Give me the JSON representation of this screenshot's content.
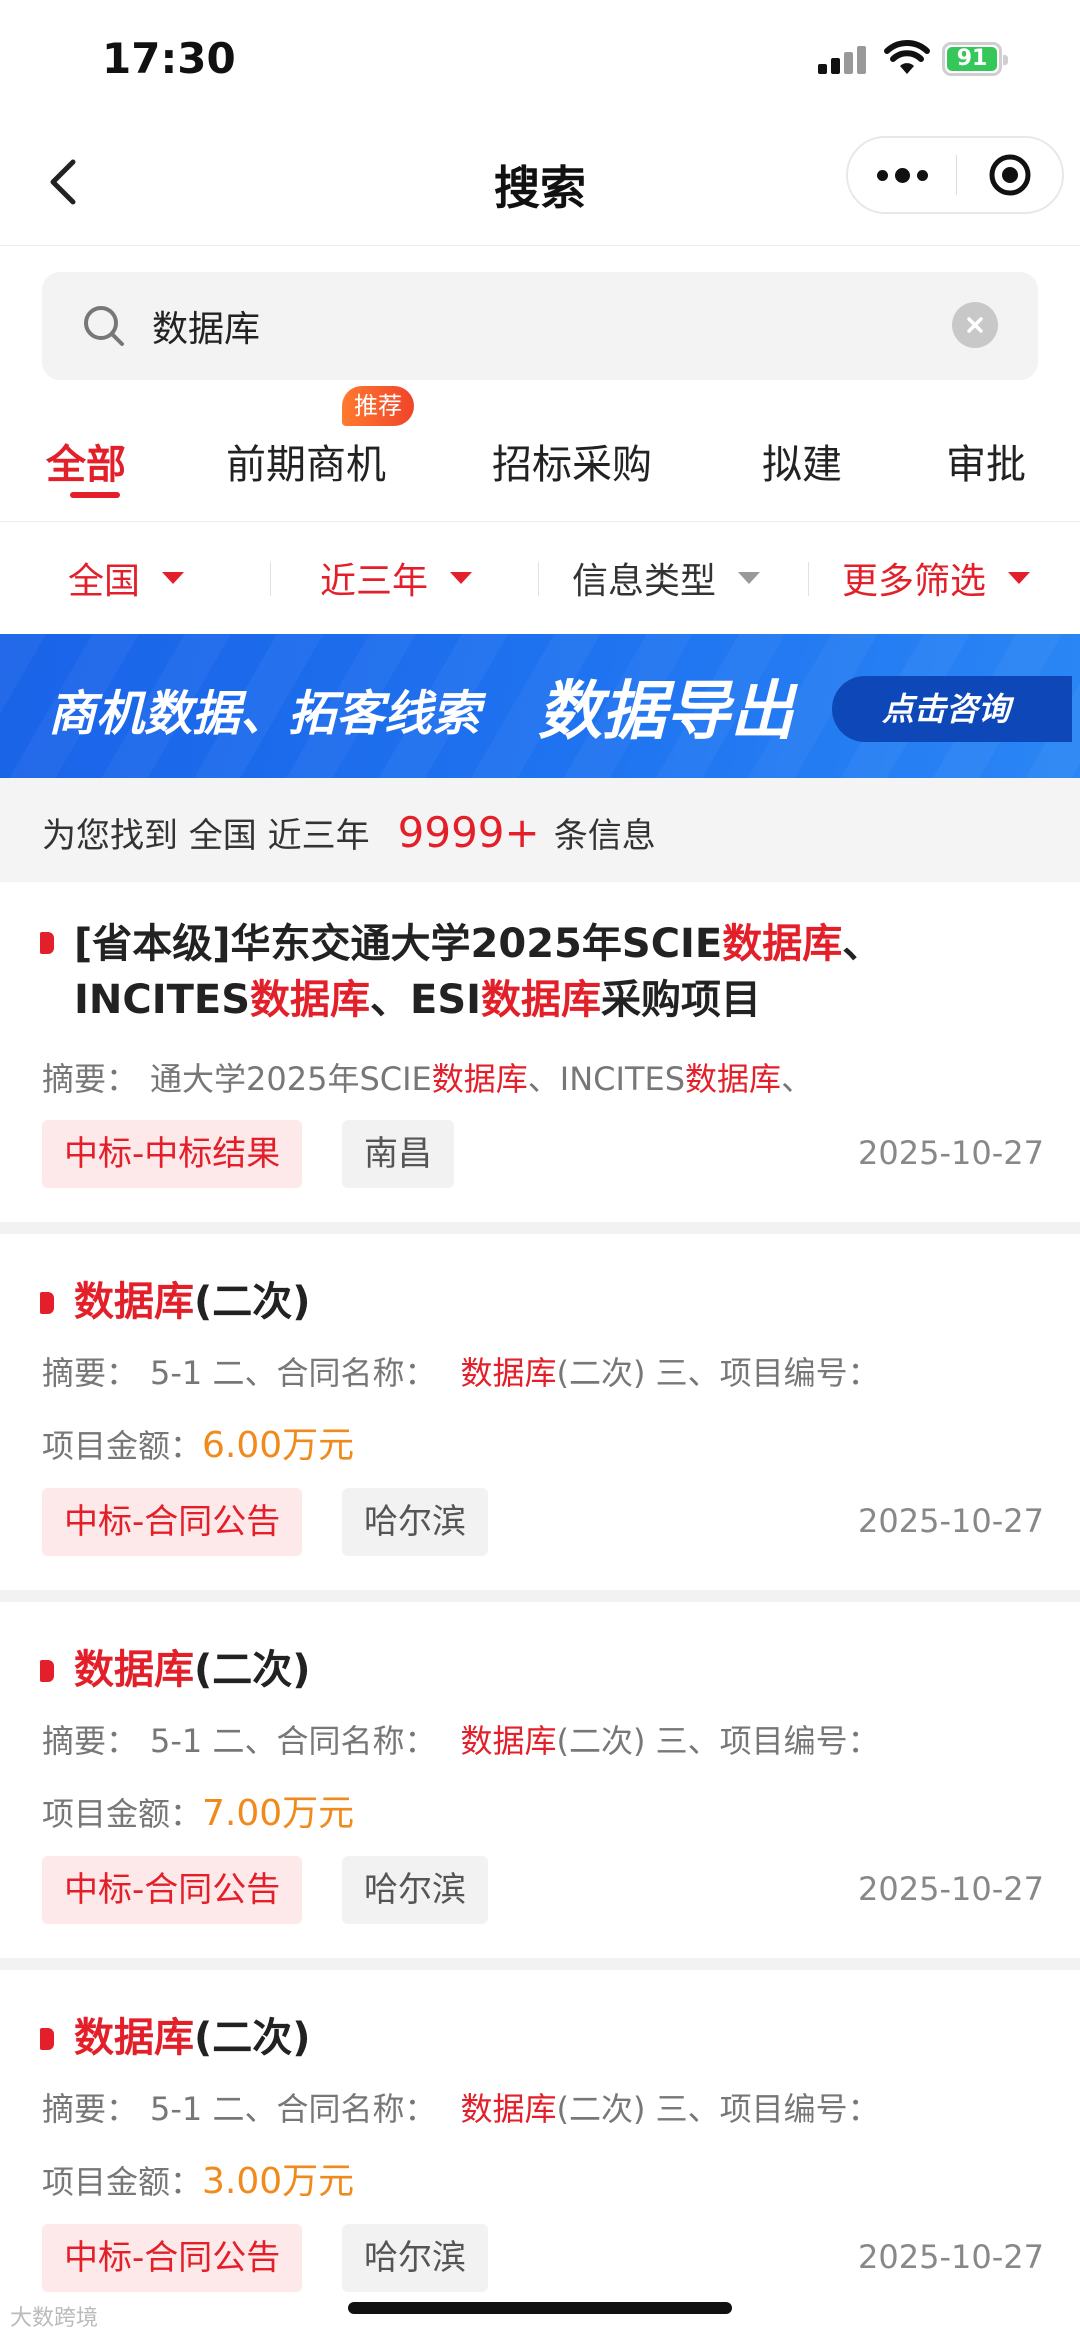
{
  "status_bar": {
    "time": "17:30",
    "battery": "91"
  },
  "nav": {
    "title": "搜索"
  },
  "search": {
    "value": "数据库",
    "placeholder": ""
  },
  "tabs": [
    {
      "label": "全部",
      "active": true
    },
    {
      "label": "前期商机",
      "badge": "推荐"
    },
    {
      "label": "招标采购"
    },
    {
      "label": "拟建"
    },
    {
      "label": "审批"
    }
  ],
  "filters": [
    {
      "label": "全国"
    },
    {
      "label": "近三年"
    },
    {
      "label": "信息类型"
    },
    {
      "label": "更多筛选"
    }
  ],
  "banner": {
    "text1": "商机数据、拓客线索",
    "text2": "数据导出",
    "cta": "点击咨询"
  },
  "summary": {
    "prefix": "为您找到 全国 近三年",
    "count": "9999+",
    "suffix": "条信息"
  },
  "results": [
    {
      "title_parts": [
        "[省本级]华东交通大学2025年SCIE",
        "数据库",
        "、INCITES",
        "数据库",
        "、ESI",
        "数据库",
        "采购项目"
      ],
      "abstract_parts": [
        "摘要：",
        "通大学2025年SCIE",
        "数据库",
        "、INCITES",
        "数据库",
        "、"
      ],
      "amount_label": "",
      "amount": "",
      "tag": "中标-中标结果",
      "region": "南昌",
      "date": "2025-10-27"
    },
    {
      "title_parts": [
        "数据库",
        "(二次)"
      ],
      "abstract_parts": [
        "摘要：",
        "5-1 二、合同名称：",
        "数据库",
        "(二次) 三、项目编号："
      ],
      "amount_label": "项目金额：",
      "amount": "6.00万元",
      "tag": "中标-合同公告",
      "region": "哈尔滨",
      "date": "2025-10-27"
    },
    {
      "title_parts": [
        "数据库",
        "(二次)"
      ],
      "abstract_parts": [
        "摘要：",
        "5-1 二、合同名称：",
        "数据库",
        "(二次) 三、项目编号："
      ],
      "amount_label": "项目金额：",
      "amount": "7.00万元",
      "tag": "中标-合同公告",
      "region": "哈尔滨",
      "date": "2025-10-27"
    },
    {
      "title_parts": [
        "数据库",
        "(二次)"
      ],
      "abstract_parts": [
        "摘要：",
        "5-1 二、合同名称：",
        "数据库",
        "(二次) 三、项目编号："
      ],
      "amount_label": "项目金额：",
      "amount": "3.00万元",
      "tag": "中标-合同公告",
      "region": "哈尔滨",
      "date": "2025-10-27"
    }
  ],
  "watermark": "大数跨境",
  "colors": {
    "accent": "#e3202a",
    "amount": "#f08a1c",
    "banner": "#1f73f0",
    "battery": "#35c759"
  }
}
